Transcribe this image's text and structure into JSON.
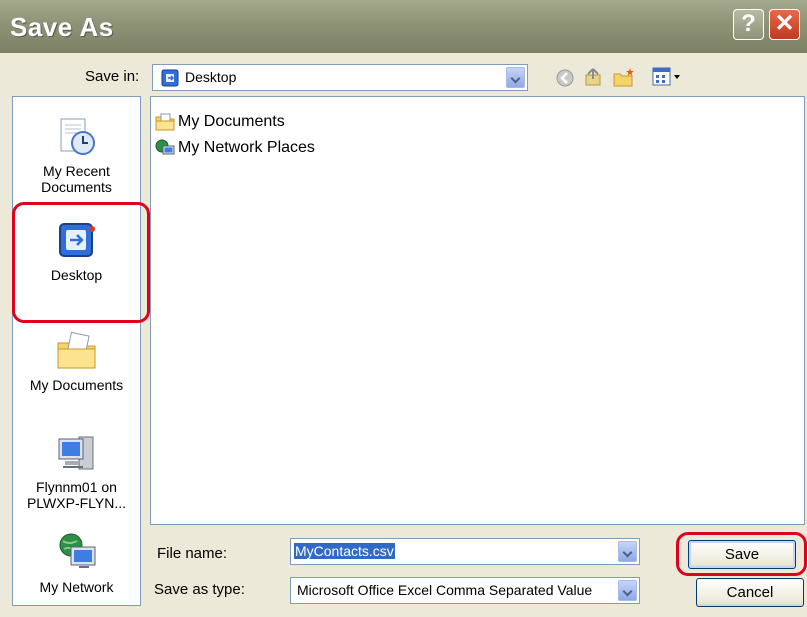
{
  "window": {
    "title": "Save As"
  },
  "toolbar": {
    "save_in_label": "Save in:",
    "location": "Desktop"
  },
  "places": [
    {
      "label": "My Recent Documents",
      "icon": "recent-documents-icon"
    },
    {
      "label": "Desktop",
      "icon": "desktop-icon"
    },
    {
      "label": "My Documents",
      "icon": "my-documents-icon"
    },
    {
      "label": "Flynnm01 on PLWXP-FLYN...",
      "icon": "computer-icon"
    },
    {
      "label": "My Network",
      "icon": "network-icon"
    }
  ],
  "files": [
    {
      "name": "My Documents",
      "icon": "folder-documents-icon"
    },
    {
      "name": "My Network Places",
      "icon": "network-places-icon"
    }
  ],
  "form": {
    "file_name_label": "File name:",
    "file_name_value": "MyContacts.csv",
    "save_type_label": "Save as type:",
    "save_type_value": "Microsoft Office Excel Comma Separated Value"
  },
  "buttons": {
    "save": "Save",
    "cancel": "Cancel"
  },
  "colors": {
    "highlight": "#e0001b",
    "selection": "#316ac5"
  }
}
